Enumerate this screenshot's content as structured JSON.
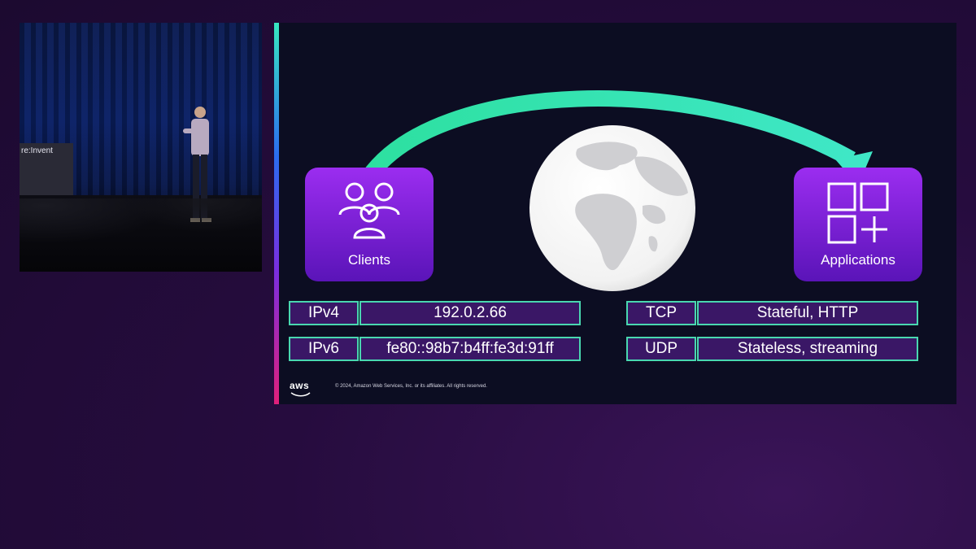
{
  "video": {
    "banner_text": "re:Invent"
  },
  "slide": {
    "clients_label": "Clients",
    "applications_label": "Applications",
    "rows": [
      {
        "key": "IPv4",
        "value": "192.0.2.66"
      },
      {
        "key": "IPv6",
        "value": "fe80::98b7:b4ff:fe3d:91ff"
      }
    ],
    "protocols": [
      {
        "key": "TCP",
        "value": "Stateful, HTTP"
      },
      {
        "key": "UDP",
        "value": "Stateless, streaming"
      }
    ],
    "footer": {
      "logo": "aws",
      "copyright": "© 2024, Amazon Web Services, Inc. or its affiliates. All rights reserved."
    }
  },
  "icons": {
    "clients": "users-icon",
    "applications": "applications-grid-icon",
    "globe": "globe-icon"
  },
  "colors": {
    "accent_teal": "#49d7b0",
    "tile_purple": "#8a24e6",
    "cell_fill": "#3a1766"
  }
}
